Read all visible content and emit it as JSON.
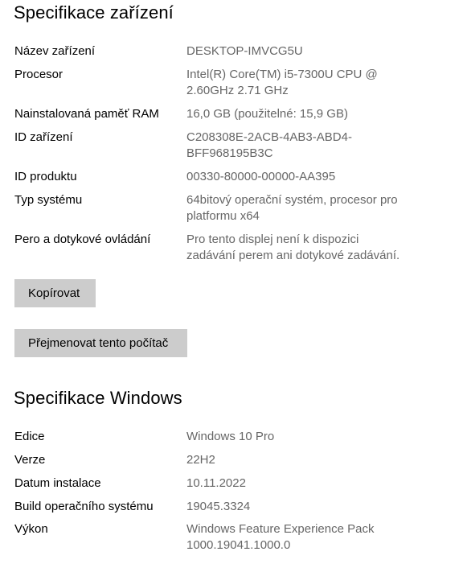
{
  "device_specs": {
    "title": "Specifikace zařízení",
    "rows": [
      {
        "label": "Název zařízení",
        "value": "DESKTOP-IMVCG5U"
      },
      {
        "label": "Procesor",
        "value": "Intel(R) Core(TM) i5-7300U CPU @\n2.60GHz   2.71 GHz"
      },
      {
        "label": "Nainstalovaná paměť RAM",
        "value": "16,0 GB (použitelné: 15,9 GB)"
      },
      {
        "label": "ID zařízení",
        "value": "C208308E-2ACB-4AB3-ABD4-\nBFF968195B3C"
      },
      {
        "label": "ID produktu",
        "value": "00330-80000-00000-AA395"
      },
      {
        "label": "Typ systému",
        "value": "64bitový operační systém, procesor pro\nplatformu x64"
      },
      {
        "label": "Pero a dotykové ovládání",
        "value": "Pro tento displej není k dispozici\nzadávání perem ani dotykové zadávání."
      }
    ],
    "copy_button": "Kopírovat",
    "rename_button": "Přejmenovat tento počítač"
  },
  "windows_specs": {
    "title": "Specifikace Windows",
    "rows": [
      {
        "label": "Edice",
        "value": "Windows 10 Pro"
      },
      {
        "label": "Verze",
        "value": "22H2"
      },
      {
        "label": "Datum instalace",
        "value": "10.11.2022"
      },
      {
        "label": "Build operačního systému",
        "value": "19045.3324"
      },
      {
        "label": "Výkon",
        "value": "Windows Feature Experience Pack\n1000.19041.1000.0"
      }
    ]
  }
}
